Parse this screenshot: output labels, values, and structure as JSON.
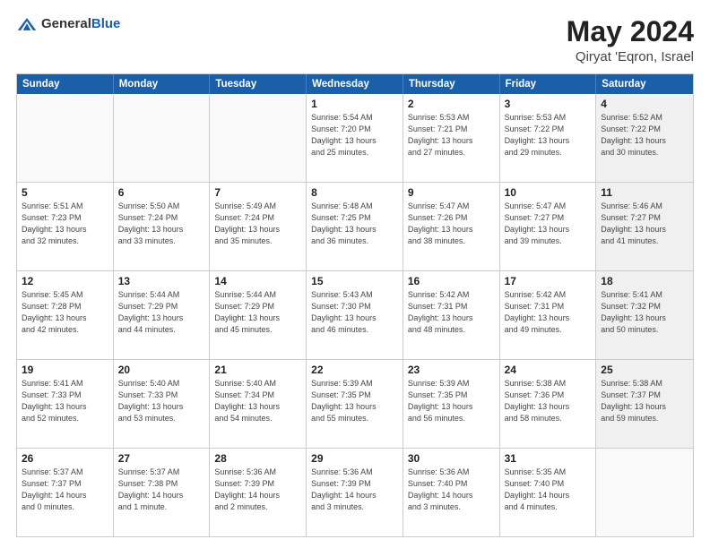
{
  "header": {
    "logo_general": "General",
    "logo_blue": "Blue",
    "title": "May 2024",
    "subtitle": "Qiryat 'Eqron, Israel"
  },
  "day_headers": [
    "Sunday",
    "Monday",
    "Tuesday",
    "Wednesday",
    "Thursday",
    "Friday",
    "Saturday"
  ],
  "weeks": [
    [
      {
        "num": "",
        "info": "",
        "empty": true
      },
      {
        "num": "",
        "info": "",
        "empty": true
      },
      {
        "num": "",
        "info": "",
        "empty": true
      },
      {
        "num": "1",
        "info": "Sunrise: 5:54 AM\nSunset: 7:20 PM\nDaylight: 13 hours\nand 25 minutes.",
        "empty": false
      },
      {
        "num": "2",
        "info": "Sunrise: 5:53 AM\nSunset: 7:21 PM\nDaylight: 13 hours\nand 27 minutes.",
        "empty": false
      },
      {
        "num": "3",
        "info": "Sunrise: 5:53 AM\nSunset: 7:22 PM\nDaylight: 13 hours\nand 29 minutes.",
        "empty": false
      },
      {
        "num": "4",
        "info": "Sunrise: 5:52 AM\nSunset: 7:22 PM\nDaylight: 13 hours\nand 30 minutes.",
        "empty": false,
        "shaded": true
      }
    ],
    [
      {
        "num": "5",
        "info": "Sunrise: 5:51 AM\nSunset: 7:23 PM\nDaylight: 13 hours\nand 32 minutes.",
        "empty": false
      },
      {
        "num": "6",
        "info": "Sunrise: 5:50 AM\nSunset: 7:24 PM\nDaylight: 13 hours\nand 33 minutes.",
        "empty": false
      },
      {
        "num": "7",
        "info": "Sunrise: 5:49 AM\nSunset: 7:24 PM\nDaylight: 13 hours\nand 35 minutes.",
        "empty": false
      },
      {
        "num": "8",
        "info": "Sunrise: 5:48 AM\nSunset: 7:25 PM\nDaylight: 13 hours\nand 36 minutes.",
        "empty": false
      },
      {
        "num": "9",
        "info": "Sunrise: 5:47 AM\nSunset: 7:26 PM\nDaylight: 13 hours\nand 38 minutes.",
        "empty": false
      },
      {
        "num": "10",
        "info": "Sunrise: 5:47 AM\nSunset: 7:27 PM\nDaylight: 13 hours\nand 39 minutes.",
        "empty": false
      },
      {
        "num": "11",
        "info": "Sunrise: 5:46 AM\nSunset: 7:27 PM\nDaylight: 13 hours\nand 41 minutes.",
        "empty": false,
        "shaded": true
      }
    ],
    [
      {
        "num": "12",
        "info": "Sunrise: 5:45 AM\nSunset: 7:28 PM\nDaylight: 13 hours\nand 42 minutes.",
        "empty": false
      },
      {
        "num": "13",
        "info": "Sunrise: 5:44 AM\nSunset: 7:29 PM\nDaylight: 13 hours\nand 44 minutes.",
        "empty": false
      },
      {
        "num": "14",
        "info": "Sunrise: 5:44 AM\nSunset: 7:29 PM\nDaylight: 13 hours\nand 45 minutes.",
        "empty": false
      },
      {
        "num": "15",
        "info": "Sunrise: 5:43 AM\nSunset: 7:30 PM\nDaylight: 13 hours\nand 46 minutes.",
        "empty": false
      },
      {
        "num": "16",
        "info": "Sunrise: 5:42 AM\nSunset: 7:31 PM\nDaylight: 13 hours\nand 48 minutes.",
        "empty": false
      },
      {
        "num": "17",
        "info": "Sunrise: 5:42 AM\nSunset: 7:31 PM\nDaylight: 13 hours\nand 49 minutes.",
        "empty": false
      },
      {
        "num": "18",
        "info": "Sunrise: 5:41 AM\nSunset: 7:32 PM\nDaylight: 13 hours\nand 50 minutes.",
        "empty": false,
        "shaded": true
      }
    ],
    [
      {
        "num": "19",
        "info": "Sunrise: 5:41 AM\nSunset: 7:33 PM\nDaylight: 13 hours\nand 52 minutes.",
        "empty": false
      },
      {
        "num": "20",
        "info": "Sunrise: 5:40 AM\nSunset: 7:33 PM\nDaylight: 13 hours\nand 53 minutes.",
        "empty": false
      },
      {
        "num": "21",
        "info": "Sunrise: 5:40 AM\nSunset: 7:34 PM\nDaylight: 13 hours\nand 54 minutes.",
        "empty": false
      },
      {
        "num": "22",
        "info": "Sunrise: 5:39 AM\nSunset: 7:35 PM\nDaylight: 13 hours\nand 55 minutes.",
        "empty": false
      },
      {
        "num": "23",
        "info": "Sunrise: 5:39 AM\nSunset: 7:35 PM\nDaylight: 13 hours\nand 56 minutes.",
        "empty": false
      },
      {
        "num": "24",
        "info": "Sunrise: 5:38 AM\nSunset: 7:36 PM\nDaylight: 13 hours\nand 58 minutes.",
        "empty": false
      },
      {
        "num": "25",
        "info": "Sunrise: 5:38 AM\nSunset: 7:37 PM\nDaylight: 13 hours\nand 59 minutes.",
        "empty": false,
        "shaded": true
      }
    ],
    [
      {
        "num": "26",
        "info": "Sunrise: 5:37 AM\nSunset: 7:37 PM\nDaylight: 14 hours\nand 0 minutes.",
        "empty": false
      },
      {
        "num": "27",
        "info": "Sunrise: 5:37 AM\nSunset: 7:38 PM\nDaylight: 14 hours\nand 1 minute.",
        "empty": false
      },
      {
        "num": "28",
        "info": "Sunrise: 5:36 AM\nSunset: 7:39 PM\nDaylight: 14 hours\nand 2 minutes.",
        "empty": false
      },
      {
        "num": "29",
        "info": "Sunrise: 5:36 AM\nSunset: 7:39 PM\nDaylight: 14 hours\nand 3 minutes.",
        "empty": false
      },
      {
        "num": "30",
        "info": "Sunrise: 5:36 AM\nSunset: 7:40 PM\nDaylight: 14 hours\nand 3 minutes.",
        "empty": false
      },
      {
        "num": "31",
        "info": "Sunrise: 5:35 AM\nSunset: 7:40 PM\nDaylight: 14 hours\nand 4 minutes.",
        "empty": false
      },
      {
        "num": "",
        "info": "",
        "empty": true,
        "shaded": true
      }
    ]
  ]
}
